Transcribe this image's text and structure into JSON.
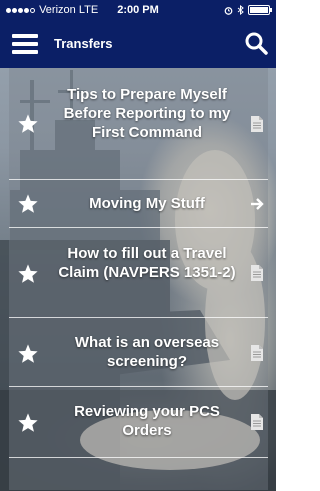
{
  "status_bar": {
    "carrier": "Verizon",
    "network": "LTE",
    "time": "2:00 PM"
  },
  "nav": {
    "title": "Transfers",
    "menu_icon": "hamburger-menu-icon",
    "search_icon": "search-icon"
  },
  "colors": {
    "nav_background": "#0b1f66",
    "row_overlay": "rgba(120,130,140,0.38)",
    "text": "#ffffff"
  },
  "items": [
    {
      "label": "Tips to Prepare Myself Before Reporting to my First Command",
      "lead_icon": "star-icon",
      "trail_icon": "document-icon"
    },
    {
      "label": "Moving My Stuff",
      "lead_icon": "star-icon",
      "trail_icon": "arrow-right-icon"
    },
    {
      "label": "How to fill out a Travel Claim (NAVPERS 1351-2)",
      "lead_icon": "star-icon",
      "trail_icon": "document-icon"
    },
    {
      "label": "What is an overseas screening?",
      "lead_icon": "star-icon",
      "trail_icon": "document-icon"
    },
    {
      "label": "Reviewing your PCS Orders",
      "lead_icon": "star-icon",
      "trail_icon": "document-icon"
    }
  ]
}
